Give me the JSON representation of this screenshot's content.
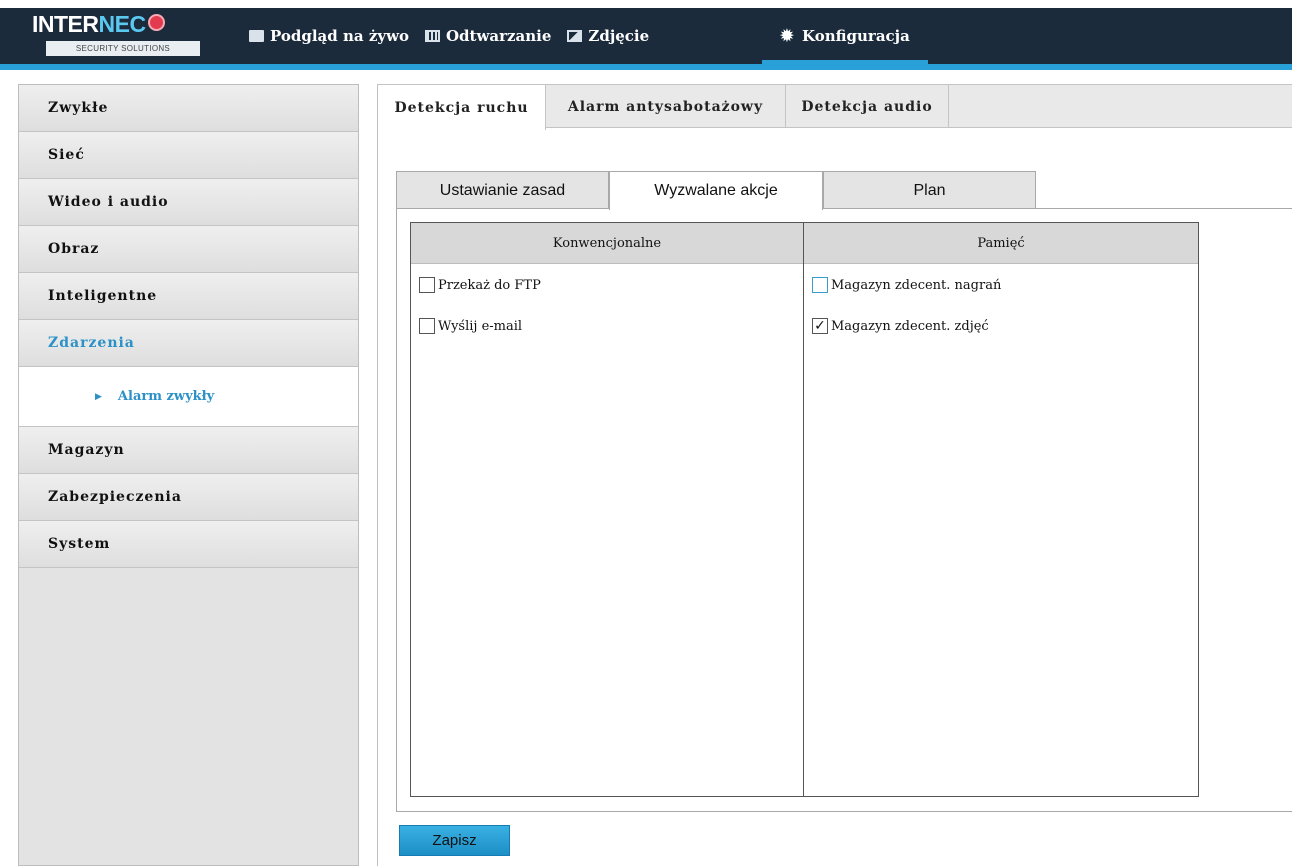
{
  "logo": {
    "main_prefix": "INTER",
    "main_accent": "NEC",
    "sub": "SECURITY SOLUTIONS"
  },
  "nav": [
    {
      "label": "Podgląd na żywo",
      "icon": "monitor-icon"
    },
    {
      "label": "Odtwarzanie",
      "icon": "film-icon"
    },
    {
      "label": "Zdjęcie",
      "icon": "photo-icon"
    },
    {
      "label": "Konfiguracja",
      "icon": "gear-icon",
      "active": true
    }
  ],
  "sidebar": {
    "items": [
      {
        "label": "Zwykłe"
      },
      {
        "label": "Sieć"
      },
      {
        "label": "Wideo i audio"
      },
      {
        "label": "Obraz"
      },
      {
        "label": "Inteligentne"
      },
      {
        "label": "Zdarzenia",
        "active": true
      },
      {
        "label": "Magazyn"
      },
      {
        "label": "Zabezpieczenia"
      },
      {
        "label": "System"
      }
    ],
    "subitem": {
      "label": "Alarm zwykły"
    }
  },
  "tabs": [
    {
      "label": "Detekcja ruchu",
      "active": true
    },
    {
      "label": "Alarm antysabotażowy"
    },
    {
      "label": "Detekcja audio"
    }
  ],
  "subtabs": [
    {
      "label": "Ustawianie zasad"
    },
    {
      "label": "Wyzwalane akcje",
      "active": true
    },
    {
      "label": "Plan"
    }
  ],
  "actions": {
    "col1_header": "Konwencjonalne",
    "col2_header": "Pamięć",
    "col1_items": [
      {
        "label": "Przekaż do FTP",
        "checked": false
      },
      {
        "label": "Wyślij e-mail",
        "checked": false
      }
    ],
    "col2_items": [
      {
        "label": "Magazyn zdecent. nagrań",
        "checked": false
      },
      {
        "label": "Magazyn zdecent. zdjęć",
        "checked": true
      }
    ]
  },
  "save_label": "Zapisz",
  "colors": {
    "accent": "#2aa0d8",
    "header_bg": "#1c2b3c",
    "active_text": "#2b91c7"
  }
}
